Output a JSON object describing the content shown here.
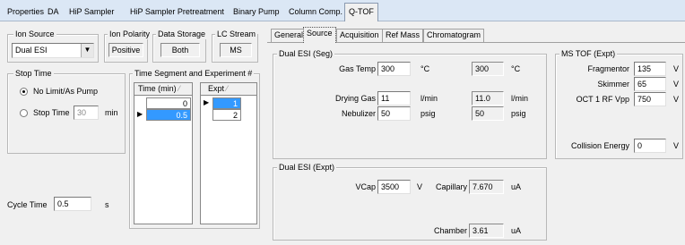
{
  "top_tabs": [
    "Properties",
    "DA",
    "HiP Sampler",
    "HiP Sampler Pretreatment",
    "Binary Pump",
    "Column Comp.",
    "Q-TOF"
  ],
  "ion_source": {
    "title": "Ion Source",
    "value": "Dual ESI"
  },
  "ion_polarity": {
    "title": "Ion Polarity",
    "value": "Positive"
  },
  "data_storage": {
    "title": "Data Storage",
    "value": "Both"
  },
  "lc_stream": {
    "title": "LC Stream",
    "value": "MS"
  },
  "stop_time": {
    "title": "Stop Time",
    "opt1": "No Limit/As Pump",
    "opt2": "Stop Time",
    "value": "30",
    "unit": "min"
  },
  "time_segment": {
    "title": "Time Segment and Experiment #",
    "col_time": "Time (min)",
    "col_expt": "Expt",
    "time_rows": [
      "0",
      "0.5"
    ],
    "expt_rows": [
      "1",
      "2"
    ]
  },
  "cycle_time": {
    "label": "Cycle Time",
    "value": "0.5",
    "unit": "s"
  },
  "sub_tabs": [
    "General",
    "Source",
    "Acquisition",
    "Ref Mass",
    "Chromatogram"
  ],
  "seg": {
    "title": "Dual ESI (Seg)",
    "gas_temp": {
      "label": "Gas Temp",
      "value": "300",
      "unit": "°C",
      "actual": "300",
      "actual_unit": "°C"
    },
    "drying_gas": {
      "label": "Drying Gas",
      "value": "11",
      "unit": "l/min",
      "actual": "11.0",
      "actual_unit": "l/min"
    },
    "nebulizer": {
      "label": "Nebulizer",
      "value": "50",
      "unit": "psig",
      "actual": "50",
      "actual_unit": "psig"
    }
  },
  "expt": {
    "title": "Dual ESI (Expt)",
    "vcap": {
      "label": "VCap",
      "value": "3500",
      "unit": "V"
    },
    "capillary": {
      "label": "Capillary",
      "value": "7.670",
      "unit": "uA"
    },
    "chamber": {
      "label": "Chamber",
      "value": "3.61",
      "unit": "uA"
    }
  },
  "ms_tof": {
    "title": "MS TOF (Expt)",
    "fragmentor": {
      "label": "Fragmentor",
      "value": "135",
      "unit": "V"
    },
    "skimmer": {
      "label": "Skimmer",
      "value": "65",
      "unit": "V"
    },
    "oct": {
      "label": "OCT 1 RF Vpp",
      "value": "750",
      "unit": "V"
    },
    "collision": {
      "label": "Collision Energy",
      "value": "0",
      "unit": "V"
    }
  }
}
